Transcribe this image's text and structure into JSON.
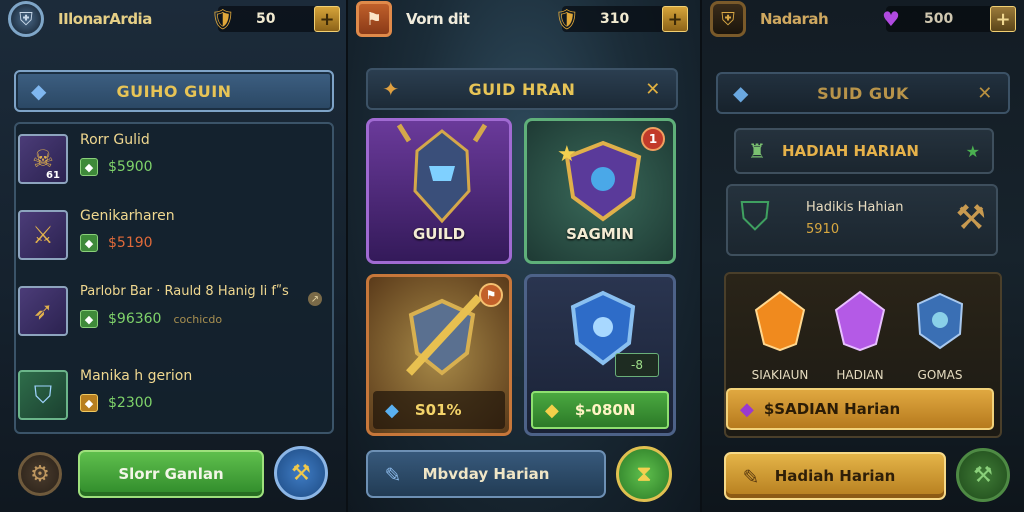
{
  "panel1": {
    "player_name": "IIlonarArdia",
    "currency_value": "50",
    "plus_label": "+",
    "header_title": "GUIHO GUIN",
    "items": [
      {
        "title": "Rorr Gulid",
        "price": "$5900",
        "icon": "monster-helmet-icon",
        "price_icon": "gem-icon",
        "badge": "61"
      },
      {
        "title": "Genikarharen",
        "price": "$5190",
        "icon": "sword-icon",
        "price_icon": "gem-icon"
      },
      {
        "title": "Parlobr Bar · Rauld 8 Hanig Ii fʺs",
        "price": "$96360",
        "extra": "cochicdo",
        "icon": "spear-icon",
        "price_icon": "gem-icon"
      },
      {
        "title": "Manika h gerion",
        "price": "$2300",
        "icon": "shield-icon",
        "price_icon": "gold-gem-icon"
      }
    ],
    "primary_button": "Slorr Ganlan"
  },
  "panel2": {
    "player_name": "Vorn dit",
    "currency_value": "310",
    "plus_label": "+",
    "header_title": "GUID HRAN",
    "card_guild_label": "GUILD",
    "card_shield_label": "SAGMIN",
    "card_shield_badge": "1",
    "card_weapon_value": "S01%",
    "card_emblem_counter": "-8",
    "card_emblem_price": "$-080N",
    "bottom_button": "Mbvday Harian"
  },
  "panel3": {
    "player_name": "Nadarah",
    "currency_value": "500",
    "plus_label": "+",
    "header_title": "SUID GUK",
    "subheader_title": "HADIAH HARIAN",
    "offer_title": "Hadikis Hahian",
    "offer_value": "5910",
    "gems": [
      {
        "label": "SIAKIAUN",
        "color": "#f08a1e"
      },
      {
        "label": "HADIAN",
        "color": "#b45ae6"
      },
      {
        "label": "GOMAS",
        "color": "#3a6fb4"
      }
    ],
    "reward_text": "$SADIAN Harian",
    "bottom_button": "Hadiah Harian"
  }
}
